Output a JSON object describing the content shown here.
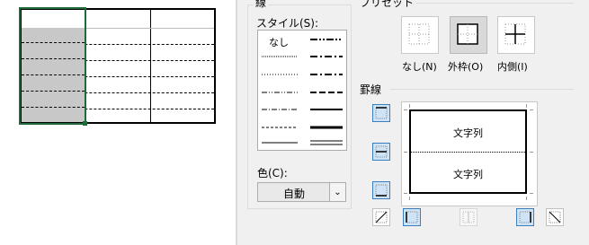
{
  "line_group": {
    "title": "線",
    "style_label": "スタイル(S):",
    "none_label": "なし",
    "color_label": "色(C):",
    "color_value": "自動"
  },
  "preset": {
    "title": "プリセット",
    "none_label": "なし(N)",
    "outline_label": "外枠(O)",
    "inside_label": "内側(I)"
  },
  "border": {
    "title": "罫線",
    "preview_text_top": "文字列",
    "preview_text_bottom": "文字列"
  },
  "colors": {
    "selection_border": "#1e6b3a",
    "selection_fill": "#c8c8c8",
    "toggle_on": "#cfe3f6",
    "toggle_on_border": "#3c7fbf"
  }
}
